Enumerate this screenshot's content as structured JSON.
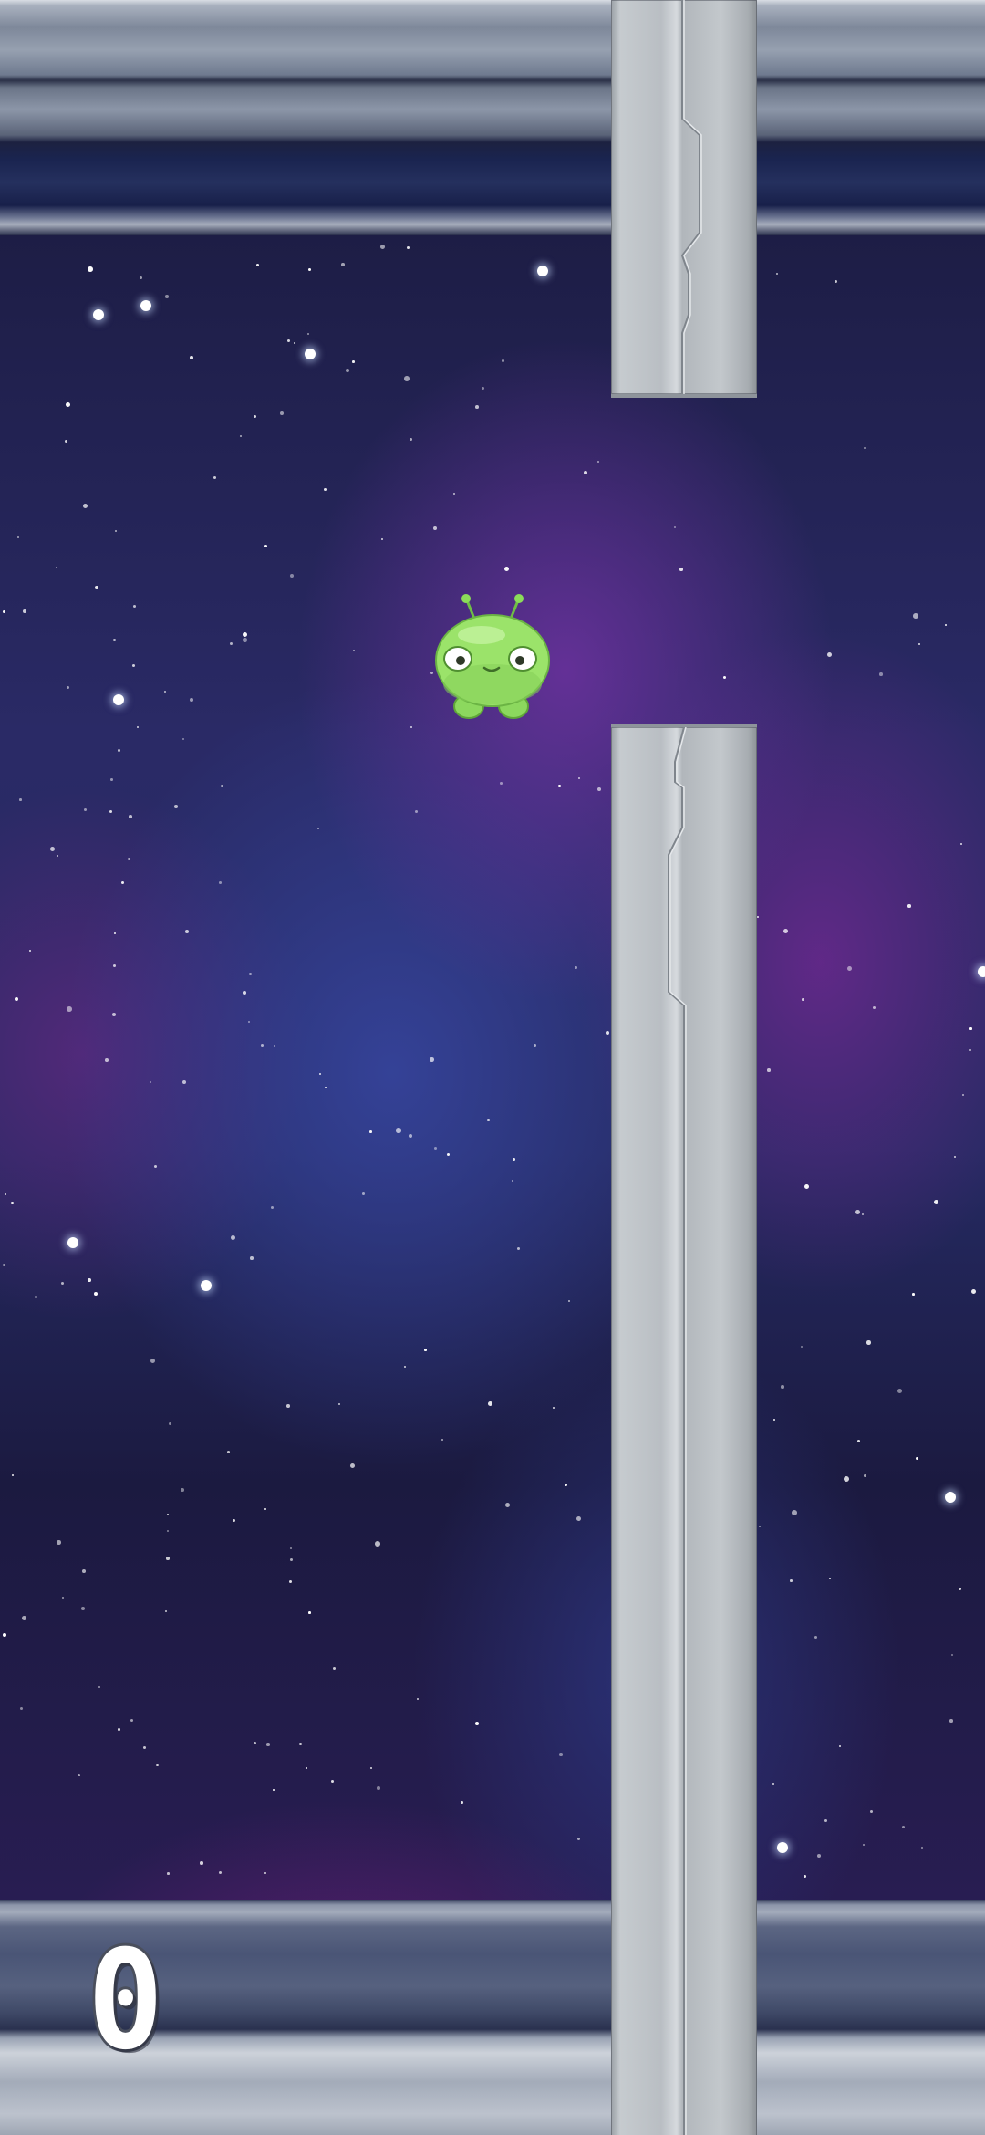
{
  "game": {
    "score": "0",
    "player": "green-alien",
    "obstacle": "metal-pipe"
  },
  "colors": {
    "space_deep": "#1d1d45",
    "nebula_purple": "#6e32a0",
    "nebula_blue": "#3746a0",
    "pipe_metal": "#b9bec3",
    "frame_metal": "#8c96a8",
    "alien_green": "#9be36a"
  }
}
